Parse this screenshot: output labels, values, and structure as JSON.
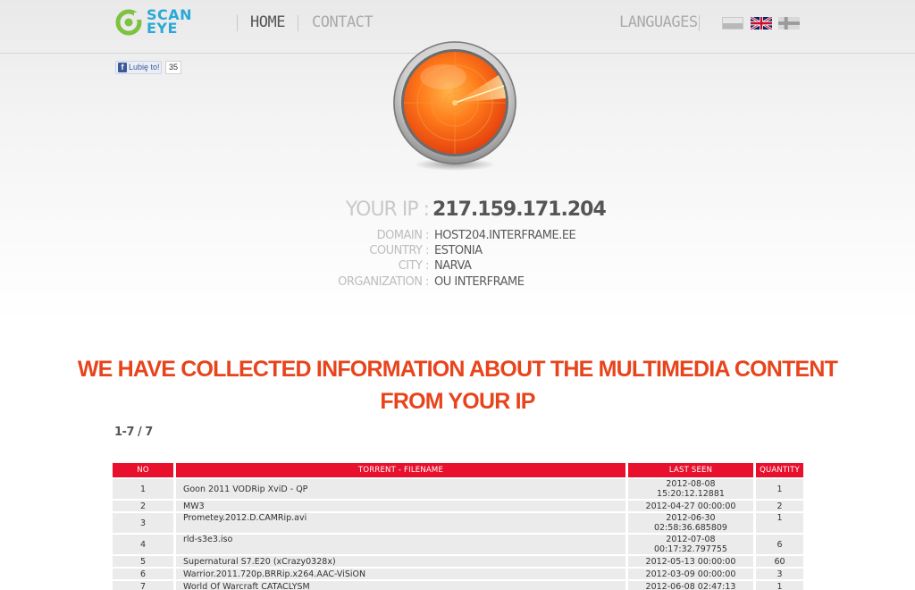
{
  "brand": {
    "line1": "SCAN",
    "line2": "EYE",
    "accent": "#2aa9d6",
    "icon_color": "#7dc241"
  },
  "nav": {
    "home": "HOME",
    "contact": "CONTACT",
    "languages": "LANGUAGES",
    "flags": [
      "flag-pl-icon",
      "flag-uk-icon",
      "flag-fi-icon"
    ]
  },
  "facebook": {
    "like_label": "Lubię to!",
    "count": "35"
  },
  "ip": {
    "label": "YOUR IP :",
    "value": "217.159.171.204",
    "details": [
      {
        "label": "DOMAIN :",
        "value": "HOST204.INTERFRAME.EE"
      },
      {
        "label": "COUNTRY :",
        "value": "ESTONIA"
      },
      {
        "label": "CITY :",
        "value": "NARVA"
      },
      {
        "label": "ORGANIZATION :",
        "value": "OU INTERFRAME"
      }
    ]
  },
  "headline": {
    "line1": "WE HAVE COLLECTED INFORMATION ABOUT THE MULTIMEDIA CONTENT",
    "line2": "FROM YOUR IP",
    "color": "#e8441c"
  },
  "results_count": "1-7 / 7",
  "table": {
    "header_color": "#e8102d",
    "columns": [
      "NO",
      "TORRENT - FILENAME",
      "LAST SEEN",
      "QUANTITY"
    ],
    "rows": [
      {
        "no": "1",
        "file": "Goon 2011 VODRip XviD - QP",
        "seen_line1": "2012-08-08 15:20:12.12881",
        "seen_line2": "",
        "qty": "1"
      },
      {
        "no": "2",
        "file": "MW3",
        "seen_line1": "2012-04-27 00:00:00",
        "seen_line2": "",
        "qty": "2"
      },
      {
        "no": "3",
        "file": "Prometey.2012.D.CAMRip.avi",
        "seen_line1": "2012-06-30",
        "seen_line2": "02:58:36.685809",
        "qty": "1"
      },
      {
        "no": "4",
        "file": "rld-s3e3.iso",
        "seen_line1": "2012-07-08",
        "seen_line2": "00:17:32.797755",
        "qty": "6"
      },
      {
        "no": "5",
        "file": "Supernatural S7.E20 (xCrazy0328x)",
        "seen_line1": "2012-05-13 00:00:00",
        "seen_line2": "",
        "qty": "60"
      },
      {
        "no": "6",
        "file": "Warrior.2011.720p.BRRip.x264.AAC-ViSiON",
        "seen_line1": "2012-03-09 00:00:00",
        "seen_line2": "",
        "qty": "3"
      },
      {
        "no": "7",
        "file": "World Of Warcraft CATACLYSM",
        "seen_line1": "2012-06-08 02:47:13",
        "seen_line2": "",
        "qty": "1"
      }
    ]
  }
}
